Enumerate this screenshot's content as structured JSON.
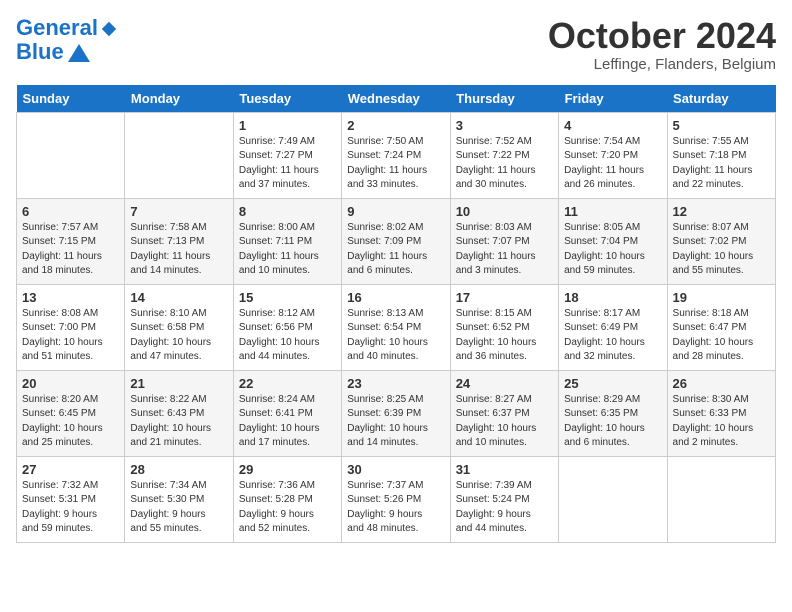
{
  "logo": {
    "line1": "General",
    "line2": "Blue"
  },
  "title": "October 2024",
  "subtitle": "Leffinge, Flanders, Belgium",
  "days_of_week": [
    "Sunday",
    "Monday",
    "Tuesday",
    "Wednesday",
    "Thursday",
    "Friday",
    "Saturday"
  ],
  "weeks": [
    [
      {
        "day": "",
        "info": ""
      },
      {
        "day": "",
        "info": ""
      },
      {
        "day": "1",
        "info": "Sunrise: 7:49 AM\nSunset: 7:27 PM\nDaylight: 11 hours\nand 37 minutes."
      },
      {
        "day": "2",
        "info": "Sunrise: 7:50 AM\nSunset: 7:24 PM\nDaylight: 11 hours\nand 33 minutes."
      },
      {
        "day": "3",
        "info": "Sunrise: 7:52 AM\nSunset: 7:22 PM\nDaylight: 11 hours\nand 30 minutes."
      },
      {
        "day": "4",
        "info": "Sunrise: 7:54 AM\nSunset: 7:20 PM\nDaylight: 11 hours\nand 26 minutes."
      },
      {
        "day": "5",
        "info": "Sunrise: 7:55 AM\nSunset: 7:18 PM\nDaylight: 11 hours\nand 22 minutes."
      }
    ],
    [
      {
        "day": "6",
        "info": "Sunrise: 7:57 AM\nSunset: 7:15 PM\nDaylight: 11 hours\nand 18 minutes."
      },
      {
        "day": "7",
        "info": "Sunrise: 7:58 AM\nSunset: 7:13 PM\nDaylight: 11 hours\nand 14 minutes."
      },
      {
        "day": "8",
        "info": "Sunrise: 8:00 AM\nSunset: 7:11 PM\nDaylight: 11 hours\nand 10 minutes."
      },
      {
        "day": "9",
        "info": "Sunrise: 8:02 AM\nSunset: 7:09 PM\nDaylight: 11 hours\nand 6 minutes."
      },
      {
        "day": "10",
        "info": "Sunrise: 8:03 AM\nSunset: 7:07 PM\nDaylight: 11 hours\nand 3 minutes."
      },
      {
        "day": "11",
        "info": "Sunrise: 8:05 AM\nSunset: 7:04 PM\nDaylight: 10 hours\nand 59 minutes."
      },
      {
        "day": "12",
        "info": "Sunrise: 8:07 AM\nSunset: 7:02 PM\nDaylight: 10 hours\nand 55 minutes."
      }
    ],
    [
      {
        "day": "13",
        "info": "Sunrise: 8:08 AM\nSunset: 7:00 PM\nDaylight: 10 hours\nand 51 minutes."
      },
      {
        "day": "14",
        "info": "Sunrise: 8:10 AM\nSunset: 6:58 PM\nDaylight: 10 hours\nand 47 minutes."
      },
      {
        "day": "15",
        "info": "Sunrise: 8:12 AM\nSunset: 6:56 PM\nDaylight: 10 hours\nand 44 minutes."
      },
      {
        "day": "16",
        "info": "Sunrise: 8:13 AM\nSunset: 6:54 PM\nDaylight: 10 hours\nand 40 minutes."
      },
      {
        "day": "17",
        "info": "Sunrise: 8:15 AM\nSunset: 6:52 PM\nDaylight: 10 hours\nand 36 minutes."
      },
      {
        "day": "18",
        "info": "Sunrise: 8:17 AM\nSunset: 6:49 PM\nDaylight: 10 hours\nand 32 minutes."
      },
      {
        "day": "19",
        "info": "Sunrise: 8:18 AM\nSunset: 6:47 PM\nDaylight: 10 hours\nand 28 minutes."
      }
    ],
    [
      {
        "day": "20",
        "info": "Sunrise: 8:20 AM\nSunset: 6:45 PM\nDaylight: 10 hours\nand 25 minutes."
      },
      {
        "day": "21",
        "info": "Sunrise: 8:22 AM\nSunset: 6:43 PM\nDaylight: 10 hours\nand 21 minutes."
      },
      {
        "day": "22",
        "info": "Sunrise: 8:24 AM\nSunset: 6:41 PM\nDaylight: 10 hours\nand 17 minutes."
      },
      {
        "day": "23",
        "info": "Sunrise: 8:25 AM\nSunset: 6:39 PM\nDaylight: 10 hours\nand 14 minutes."
      },
      {
        "day": "24",
        "info": "Sunrise: 8:27 AM\nSunset: 6:37 PM\nDaylight: 10 hours\nand 10 minutes."
      },
      {
        "day": "25",
        "info": "Sunrise: 8:29 AM\nSunset: 6:35 PM\nDaylight: 10 hours\nand 6 minutes."
      },
      {
        "day": "26",
        "info": "Sunrise: 8:30 AM\nSunset: 6:33 PM\nDaylight: 10 hours\nand 2 minutes."
      }
    ],
    [
      {
        "day": "27",
        "info": "Sunrise: 7:32 AM\nSunset: 5:31 PM\nDaylight: 9 hours\nand 59 minutes."
      },
      {
        "day": "28",
        "info": "Sunrise: 7:34 AM\nSunset: 5:30 PM\nDaylight: 9 hours\nand 55 minutes."
      },
      {
        "day": "29",
        "info": "Sunrise: 7:36 AM\nSunset: 5:28 PM\nDaylight: 9 hours\nand 52 minutes."
      },
      {
        "day": "30",
        "info": "Sunrise: 7:37 AM\nSunset: 5:26 PM\nDaylight: 9 hours\nand 48 minutes."
      },
      {
        "day": "31",
        "info": "Sunrise: 7:39 AM\nSunset: 5:24 PM\nDaylight: 9 hours\nand 44 minutes."
      },
      {
        "day": "",
        "info": ""
      },
      {
        "day": "",
        "info": ""
      }
    ]
  ]
}
